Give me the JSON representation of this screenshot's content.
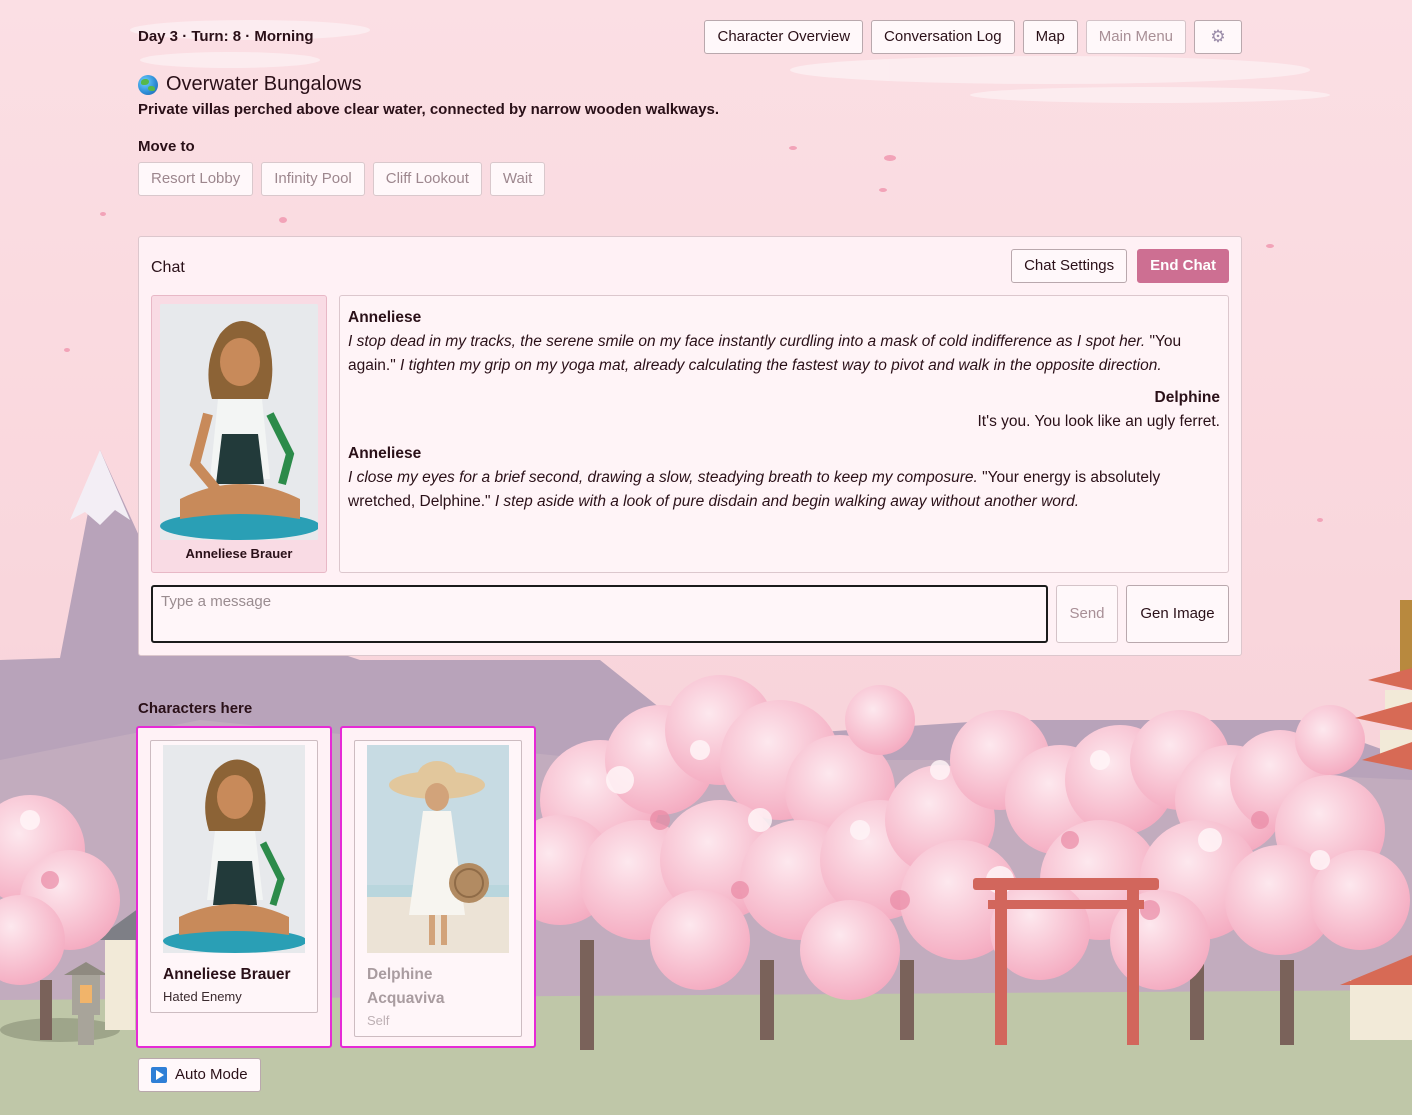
{
  "header": {
    "day_turn": "Day 3 · Turn: 8 · Morning",
    "nav": {
      "character_overview": "Character Overview",
      "conversation_log": "Conversation Log",
      "map": "Map",
      "main_menu": "Main Menu",
      "settings_icon": "gear-icon"
    }
  },
  "location": {
    "icon": "globe-icon",
    "title": "Overwater Bungalows",
    "description": "Private villas perched above clear water, connected by narrow wooden walkways."
  },
  "move": {
    "label": "Move to",
    "options": [
      "Resort Lobby",
      "Infinity Pool",
      "Cliff Lookout",
      "Wait"
    ]
  },
  "chat": {
    "title": "Chat",
    "settings_label": "Chat Settings",
    "end_label": "End Chat",
    "portrait_caption": "Anneliese Brauer",
    "messages": [
      {
        "speaker": "Anneliese",
        "part1": "I stop dead in my tracks, the serene smile on my face instantly curdling into a mask of cold indifference as I spot her.",
        "part2": " \"You again.\" ",
        "part3": "I tighten my grip on my yoga mat, already calculating the fastest way to pivot and walk in the opposite direction."
      },
      {
        "speaker": "Delphine",
        "text": "It's you. You look like an ugly ferret."
      },
      {
        "speaker": "Anneliese",
        "part1": "I close my eyes for a brief second, drawing a slow, steadying breath to keep my composure.",
        "part2": " \"Your energy is absolutely wretched, Delphine.\" ",
        "part3": "I step aside with a look of pure disdain and begin walking away without another word."
      }
    ],
    "input_placeholder": "Type a message",
    "send_label": "Send",
    "gen_image_label": "Gen Image"
  },
  "characters": {
    "label": "Characters here",
    "list": [
      {
        "name": "Anneliese Brauer",
        "role": "Hated Enemy"
      },
      {
        "name": "Delphine Acquaviva",
        "role": "Self"
      }
    ]
  },
  "auto_mode": {
    "label": "Auto Mode",
    "icon": "play-icon"
  },
  "colors": {
    "accent": "#cd6f92",
    "selection_border": "#e62ad6",
    "panel_bg": "#fff1f5"
  }
}
